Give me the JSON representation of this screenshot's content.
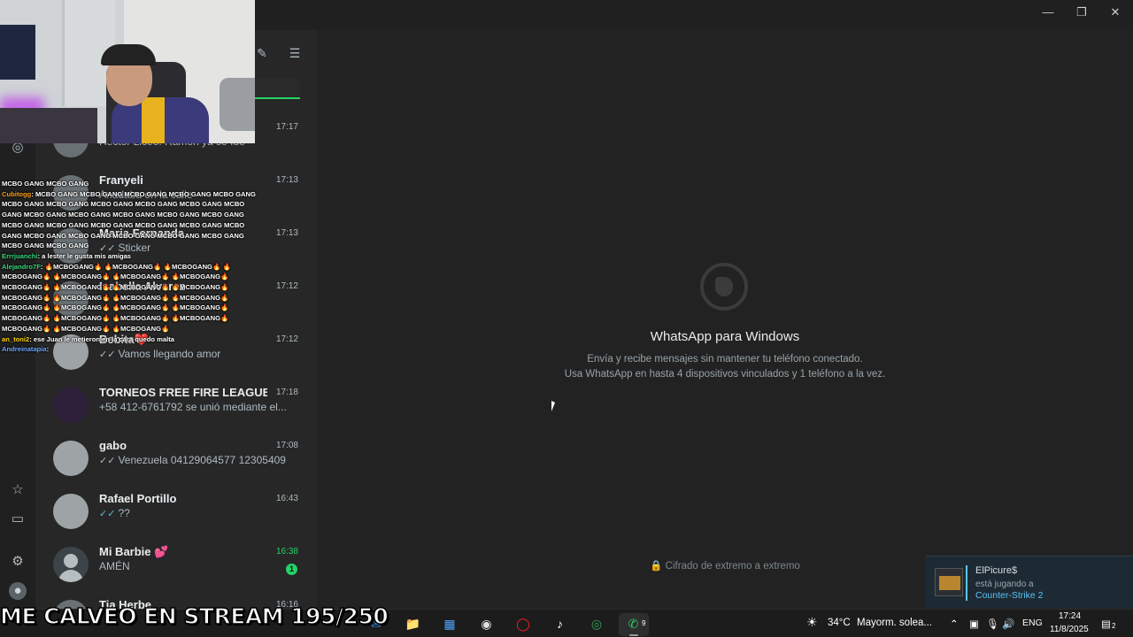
{
  "window": {
    "minimize": "—",
    "restore": "❐",
    "close": "✕"
  },
  "header": {
    "new_chat_icon": "compose-icon",
    "filter_icon": "filter-icon"
  },
  "rail": {
    "status_icon": "status-icon",
    "starred_icon": "star-icon",
    "archived_icon": "archive-icon",
    "settings_icon": "gear-icon",
    "profile_icon": "avatar"
  },
  "chats": [
    {
      "name": "",
      "time": "17:17",
      "message": "Hector Liceo: Ramón ya se fue",
      "tick": "",
      "avatar": "gray"
    },
    {
      "name": "Franyeli",
      "time": "17:13",
      "message": "Anadaba en la calle",
      "tick": "",
      "avatar": "gray"
    },
    {
      "name": "Maria Fernanda",
      "time": "17:13",
      "message": "Sticker",
      "tick": "✓✓",
      "avatar": "gray"
    },
    {
      "name": "Isabella Alvarez",
      "time": "17:12",
      "message": "",
      "tick": "",
      "avatar": "gray"
    },
    {
      "name": "Bebita❤️",
      "time": "17:12",
      "message": "Vamos llegando amor",
      "tick": "✓✓",
      "avatar": "light"
    },
    {
      "name": "TORNEOS FREE FIRE LEAGUE VE...",
      "time": "17:18",
      "message": "+58 412-6761792 se unió mediante el...",
      "tick": "",
      "avatar": "dark"
    },
    {
      "name": "gabo",
      "time": "17:08",
      "message": "Venezuela  04129064577  12305409",
      "tick": "✓✓",
      "avatar": "light"
    },
    {
      "name": "Rafael Portillo",
      "time": "16:43",
      "message": "??",
      "tick": "✓✓",
      "avatar": "light"
    },
    {
      "name": "Mi Barbie 💕",
      "time": "16:38",
      "message": "AMÉN",
      "tick": "",
      "avatar": "placeholder",
      "unread": "1"
    },
    {
      "name": "Tia Herbe",
      "time": "16:16",
      "message": "",
      "tick": "",
      "avatar": "gray"
    }
  ],
  "main": {
    "title": "WhatsApp para Windows",
    "desc1": "Envía y recibe mensajes sin mantener tu teléfono conectado.",
    "desc2": "Usa WhatsApp en hasta 4 dispositivos vinculados y 1 teléfono a la vez.",
    "encrypted": "🔒 Cifrado de extremo a extremo"
  },
  "stream_chat": [
    {
      "nick": "",
      "nick_color": "#ffffff",
      "text": "MCBO GANG MCBO GANG"
    },
    {
      "nick": "Cubitogg",
      "nick_color": "#ff9f1c",
      "text": ": MCBO GANG MCBO GANG MCBO GANG MCBO GANG MCBO GANG"
    },
    {
      "nick": "",
      "nick_color": "#ffffff",
      "text": "MCBO GANG MCBO GANG MCBO GANG MCBO GANG MCBO GANG MCBO"
    },
    {
      "nick": "",
      "nick_color": "#ffffff",
      "text": "GANG MCBO GANG MCBO GANG MCBO GANG MCBO GANG MCBO GANG"
    },
    {
      "nick": "",
      "nick_color": "#ffffff",
      "text": "MCBO GANG MCBO GANG MCBO GANG MCBO GANG MCBO GANG MCBO"
    },
    {
      "nick": "",
      "nick_color": "#ffffff",
      "text": "GANG MCBO GANG MCBO GANG MCBO GANG MCBO GANG MCBO GANG"
    },
    {
      "nick": "",
      "nick_color": "#ffffff",
      "text": "MCBO GANG MCBO GANG"
    },
    {
      "nick": "Errrjuanchi",
      "nick_color": "#37d67a",
      "text": ": a lester le gusta mis amigas"
    },
    {
      "nick": "Alejandro7F",
      "nick_color": "#37d67a",
      "text": ": 🔥MCBOGANG🔥 🔥MCBOGANG🔥 🔥MCBOGANG🔥 🔥"
    },
    {
      "nick": "",
      "nick_color": "#ffffff",
      "text": "MCBOGANG🔥 🔥MCBOGANG🔥 🔥MCBOGANG🔥 🔥MCBOGANG🔥"
    },
    {
      "nick": "",
      "nick_color": "#ffffff",
      "text": "MCBOGANG🔥 🔥MCBOGANG🔥 🔥MCBOGANG🔥 🔥MCBOGANG🔥"
    },
    {
      "nick": "",
      "nick_color": "#ffffff",
      "text": "MCBOGANG🔥 🔥MCBOGANG🔥 🔥MCBOGANG🔥 🔥MCBOGANG🔥"
    },
    {
      "nick": "",
      "nick_color": "#ffffff",
      "text": "MCBOGANG🔥 🔥MCBOGANG🔥 🔥MCBOGANG🔥 🔥MCBOGANG🔥"
    },
    {
      "nick": "",
      "nick_color": "#ffffff",
      "text": "MCBOGANG🔥 🔥MCBOGANG🔥 🔥MCBOGANG🔥 🔥MCBOGANG🔥"
    },
    {
      "nick": "",
      "nick_color": "#ffffff",
      "text": "MCBOGANG🔥 🔥MCBOGANG🔥 🔥MCBOGANG🔥"
    },
    {
      "nick": "an_toni2",
      "nick_color": "#ffd400",
      "text": ": ese Juan le metieron en la cara quedo malta"
    },
    {
      "nick": "Andreinatapia",
      "nick_color": "#6aa6ff",
      "text": ":"
    }
  ],
  "overlay": {
    "counter": "ME CALVEO EN STREAM 195/250"
  },
  "taskbar": {
    "apps": [
      {
        "name": "outlook-icon",
        "glyph": "✉",
        "color": "#2f7fd8"
      },
      {
        "name": "file-explorer-icon",
        "glyph": "📁",
        "color": "#f2c94c"
      },
      {
        "name": "store-icon",
        "glyph": "▦",
        "color": "#4fa3f7"
      },
      {
        "name": "obs-icon",
        "glyph": "◉",
        "color": "#e0e0e0"
      },
      {
        "name": "opera-icon",
        "glyph": "◯",
        "color": "#ff1b2d"
      },
      {
        "name": "tiktok-icon",
        "glyph": "♪",
        "color": "#ffffff"
      },
      {
        "name": "chrome-icon",
        "glyph": "◎",
        "color": "#34a853"
      },
      {
        "name": "whatsapp-icon",
        "glyph": "✆",
        "color": "#25d366",
        "badge": "9"
      }
    ],
    "weather_temp": "34°C",
    "weather_text": "Mayorm. solea...",
    "lang": "ENG",
    "time": "17:24",
    "date": "11/8/2025",
    "notifications": "2"
  },
  "toast": {
    "name": "ElPicure$",
    "status": "está jugando a",
    "game": "Counter-Strike 2"
  }
}
